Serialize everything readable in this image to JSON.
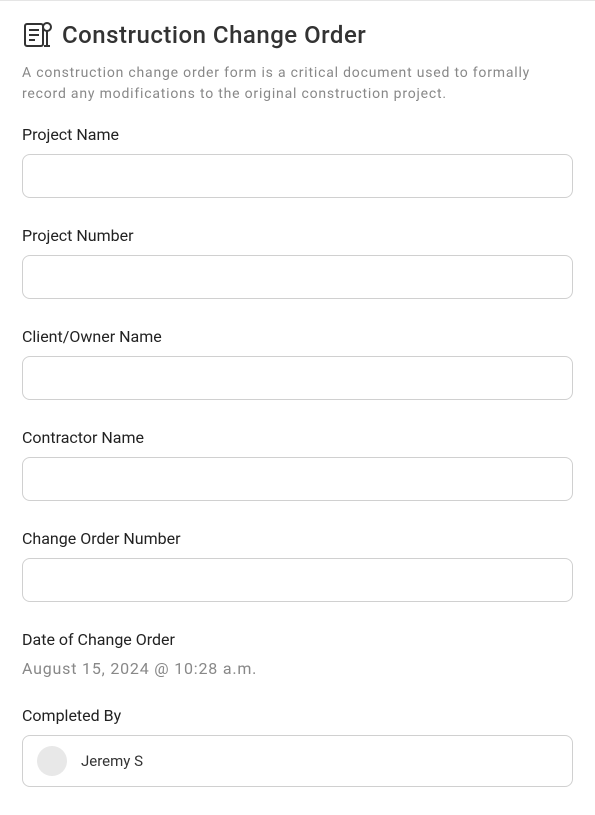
{
  "form": {
    "title": "Construction Change Order",
    "description": "A construction change order form is a critical document used to formally record any modifications to the original construction project.",
    "fields": {
      "project_name": {
        "label": "Project Name",
        "value": ""
      },
      "project_number": {
        "label": "Project Number",
        "value": ""
      },
      "client_owner_name": {
        "label": "Client/Owner Name",
        "value": ""
      },
      "contractor_name": {
        "label": "Contractor Name",
        "value": ""
      },
      "change_order_number": {
        "label": "Change Order Number",
        "value": ""
      },
      "date_of_change_order": {
        "label": "Date of Change Order",
        "value": "August 15, 2024 @ 10:28 a.m."
      },
      "completed_by": {
        "label": "Completed By",
        "user_name": "Jeremy S"
      }
    }
  }
}
